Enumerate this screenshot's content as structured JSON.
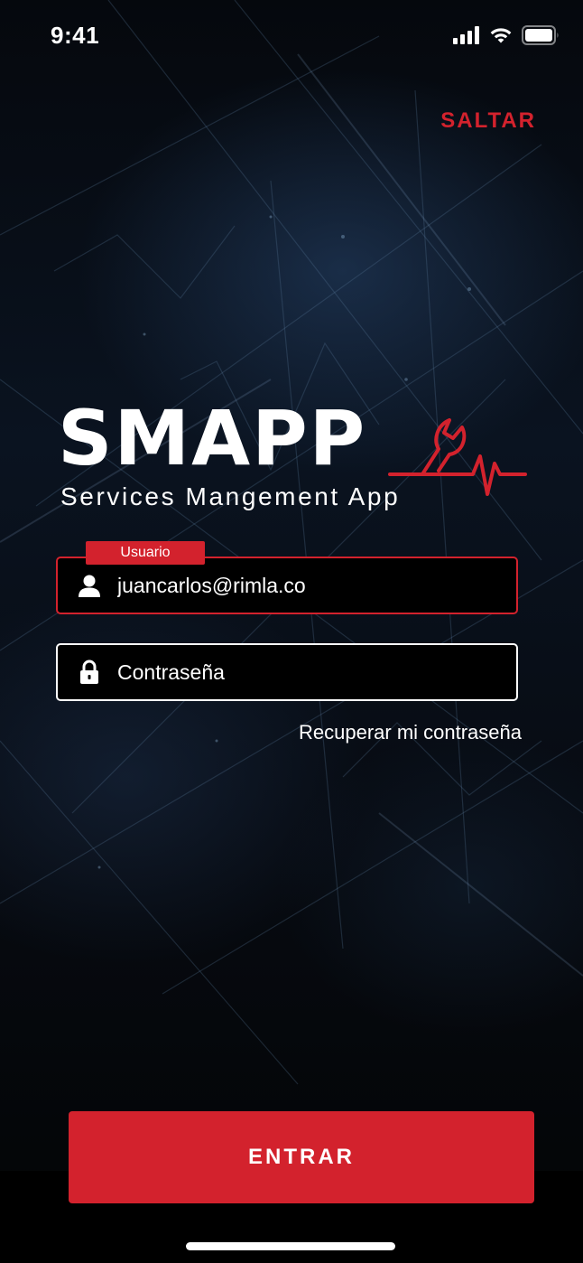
{
  "status_bar": {
    "time": "9:41",
    "icons": [
      "cellular-signal-icon",
      "wifi-icon",
      "battery-icon"
    ]
  },
  "header": {
    "skip_label": "SALTAR"
  },
  "logo": {
    "wordmark": "SMAPP",
    "tagline": "Services Mangement App",
    "emblem_icon": "wrench-heartbeat-icon"
  },
  "form": {
    "username": {
      "tag_label": "Usuario",
      "value": "juancarlos@rimla.co",
      "icon": "user-icon"
    },
    "password": {
      "placeholder": "Contraseña",
      "value": "",
      "icon": "lock-icon"
    },
    "recover_label": "Recuperar mi contraseña",
    "submit_label": "ENTRAR"
  },
  "colors": {
    "accent": "#d3222d",
    "text": "#ffffff",
    "background": "#05080d"
  }
}
